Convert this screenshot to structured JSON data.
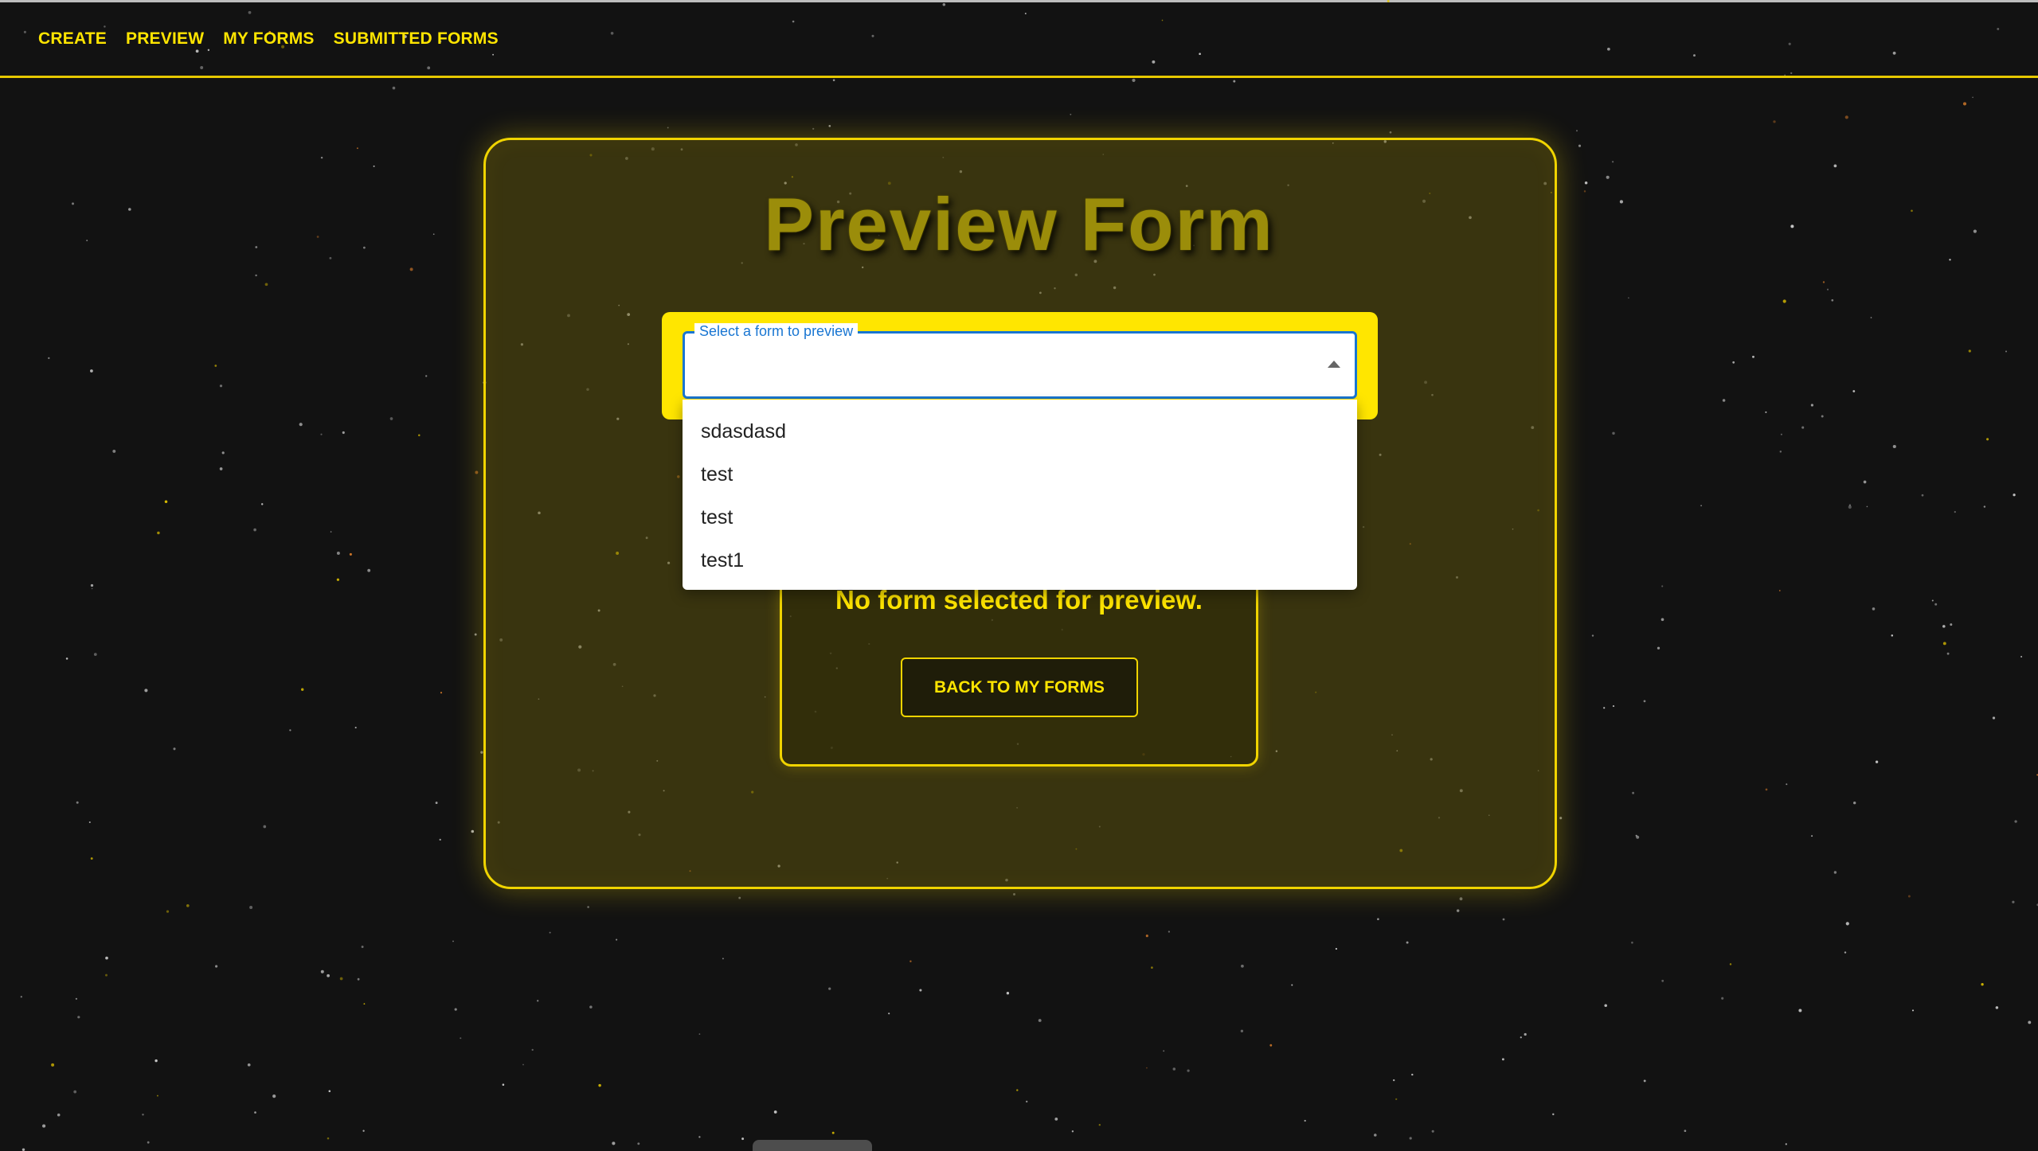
{
  "nav": {
    "items": [
      "CREATE",
      "PREVIEW",
      "MY FORMS",
      "SUBMITTED FORMS"
    ]
  },
  "page": {
    "title": "Preview Form"
  },
  "select": {
    "label": "Select a form to preview",
    "value": "",
    "options": [
      "sdasdasd",
      "test",
      "test",
      "test1"
    ]
  },
  "empty_state": {
    "message": "No form selected for preview.",
    "button_label": "BACK TO MY FORMS"
  },
  "colors": {
    "accent": "#ffe500",
    "background": "#121212",
    "focus": "#1976d2"
  },
  "icons": {
    "select_caret": "caret-up-icon"
  }
}
